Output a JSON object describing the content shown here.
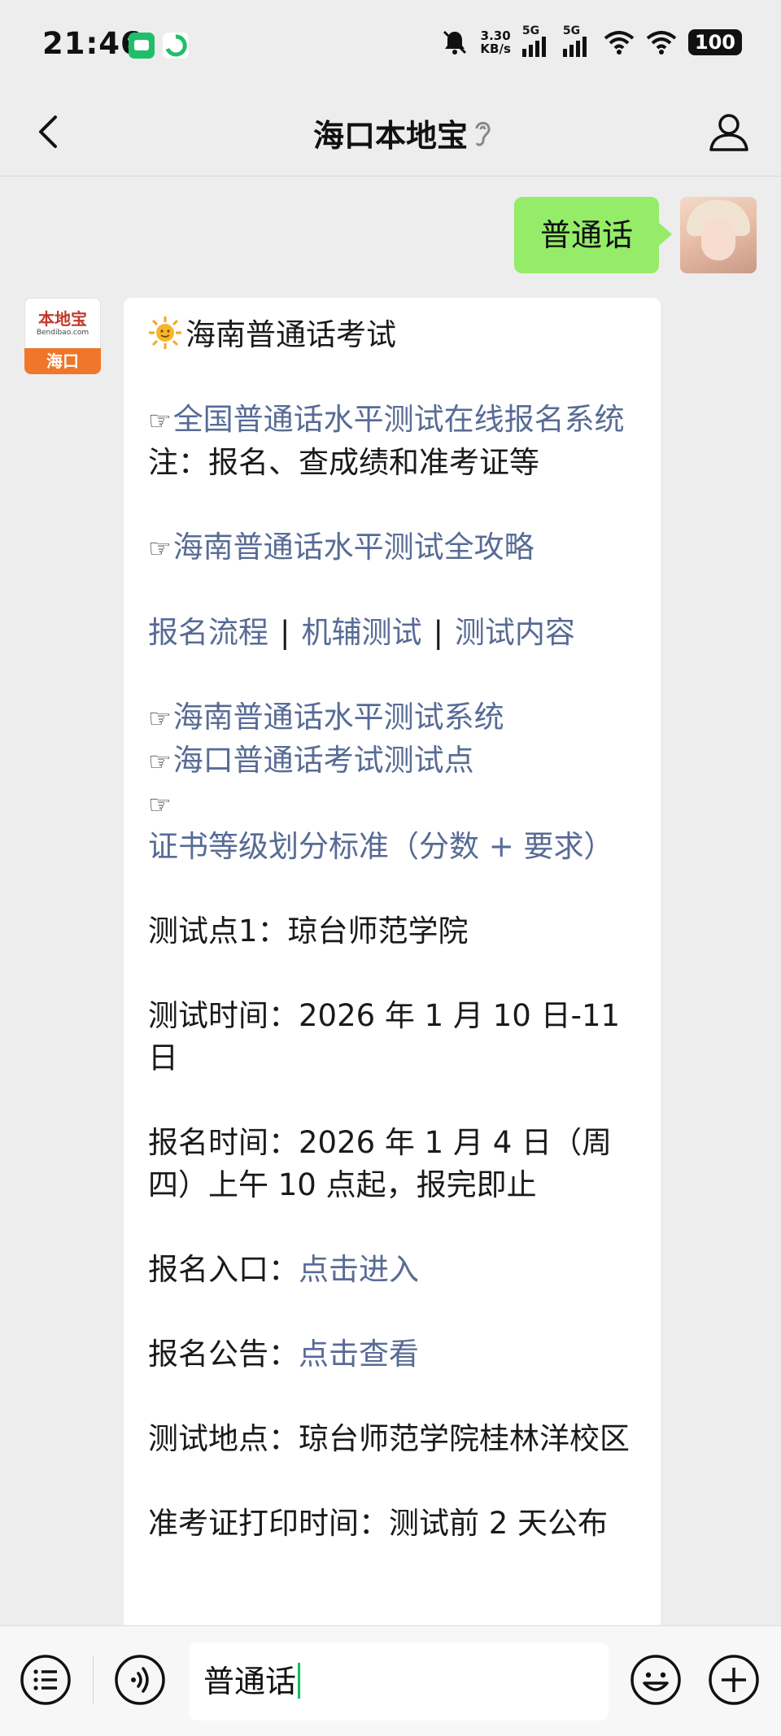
{
  "status_bar": {
    "time": "21:46",
    "speed_value": "3.30",
    "speed_unit": "KB/s",
    "net1": "5G",
    "net2": "5G",
    "battery": "100",
    "icons": [
      "message-app-icon",
      "vpn-app-icon",
      "mute-icon",
      "signal-icon",
      "wifi-icon",
      "battery-icon"
    ]
  },
  "nav": {
    "title": "海口本地宝",
    "back_icon": "back-chevron-icon",
    "ear_icon": "ear-icon",
    "profile_icon": "user-icon"
  },
  "outgoing_message": {
    "text": "普通话"
  },
  "bot_avatar": {
    "logo_text": "本地宝",
    "logo_en": "Bendibao.com",
    "city": "海口"
  },
  "incoming_message": {
    "title": "海南普通话考试",
    "link1": "全国普通话水平测试在线报名系统",
    "note": "注：报名、查成绩和准考证等",
    "link2": "海南普通话水平测试全攻略",
    "quick_links": [
      "报名流程",
      "机辅测试",
      "测试内容"
    ],
    "separator": "|",
    "link3": "海南普通话水平测试系统",
    "link4": "海口普通话考试测试点",
    "link5": "证书等级划分标准（分数 + 要求）",
    "hand_symbol": "☞",
    "site_line": "测试点1：琼台师范学院",
    "time_line": "测试时间：2026 年 1 月 10 日-11 日",
    "signup_line": "报名时间：2026 年 1 月 4 日（周四）上午 10 点起，报完即止",
    "entry_label": "报名入口：",
    "entry_link": "点击进入",
    "notice_label": "报名公告：",
    "notice_link": "点击查看",
    "place_line": "测试地点：琼台师范学院桂林洋校区",
    "print_line": "准考证打印时间：测试前 2 天公布"
  },
  "input_bar": {
    "text": "普通话",
    "menu_icon": "menu-list-icon",
    "voice_icon": "voice-icon",
    "emoji_icon": "emoji-icon",
    "plus_icon": "plus-icon"
  }
}
